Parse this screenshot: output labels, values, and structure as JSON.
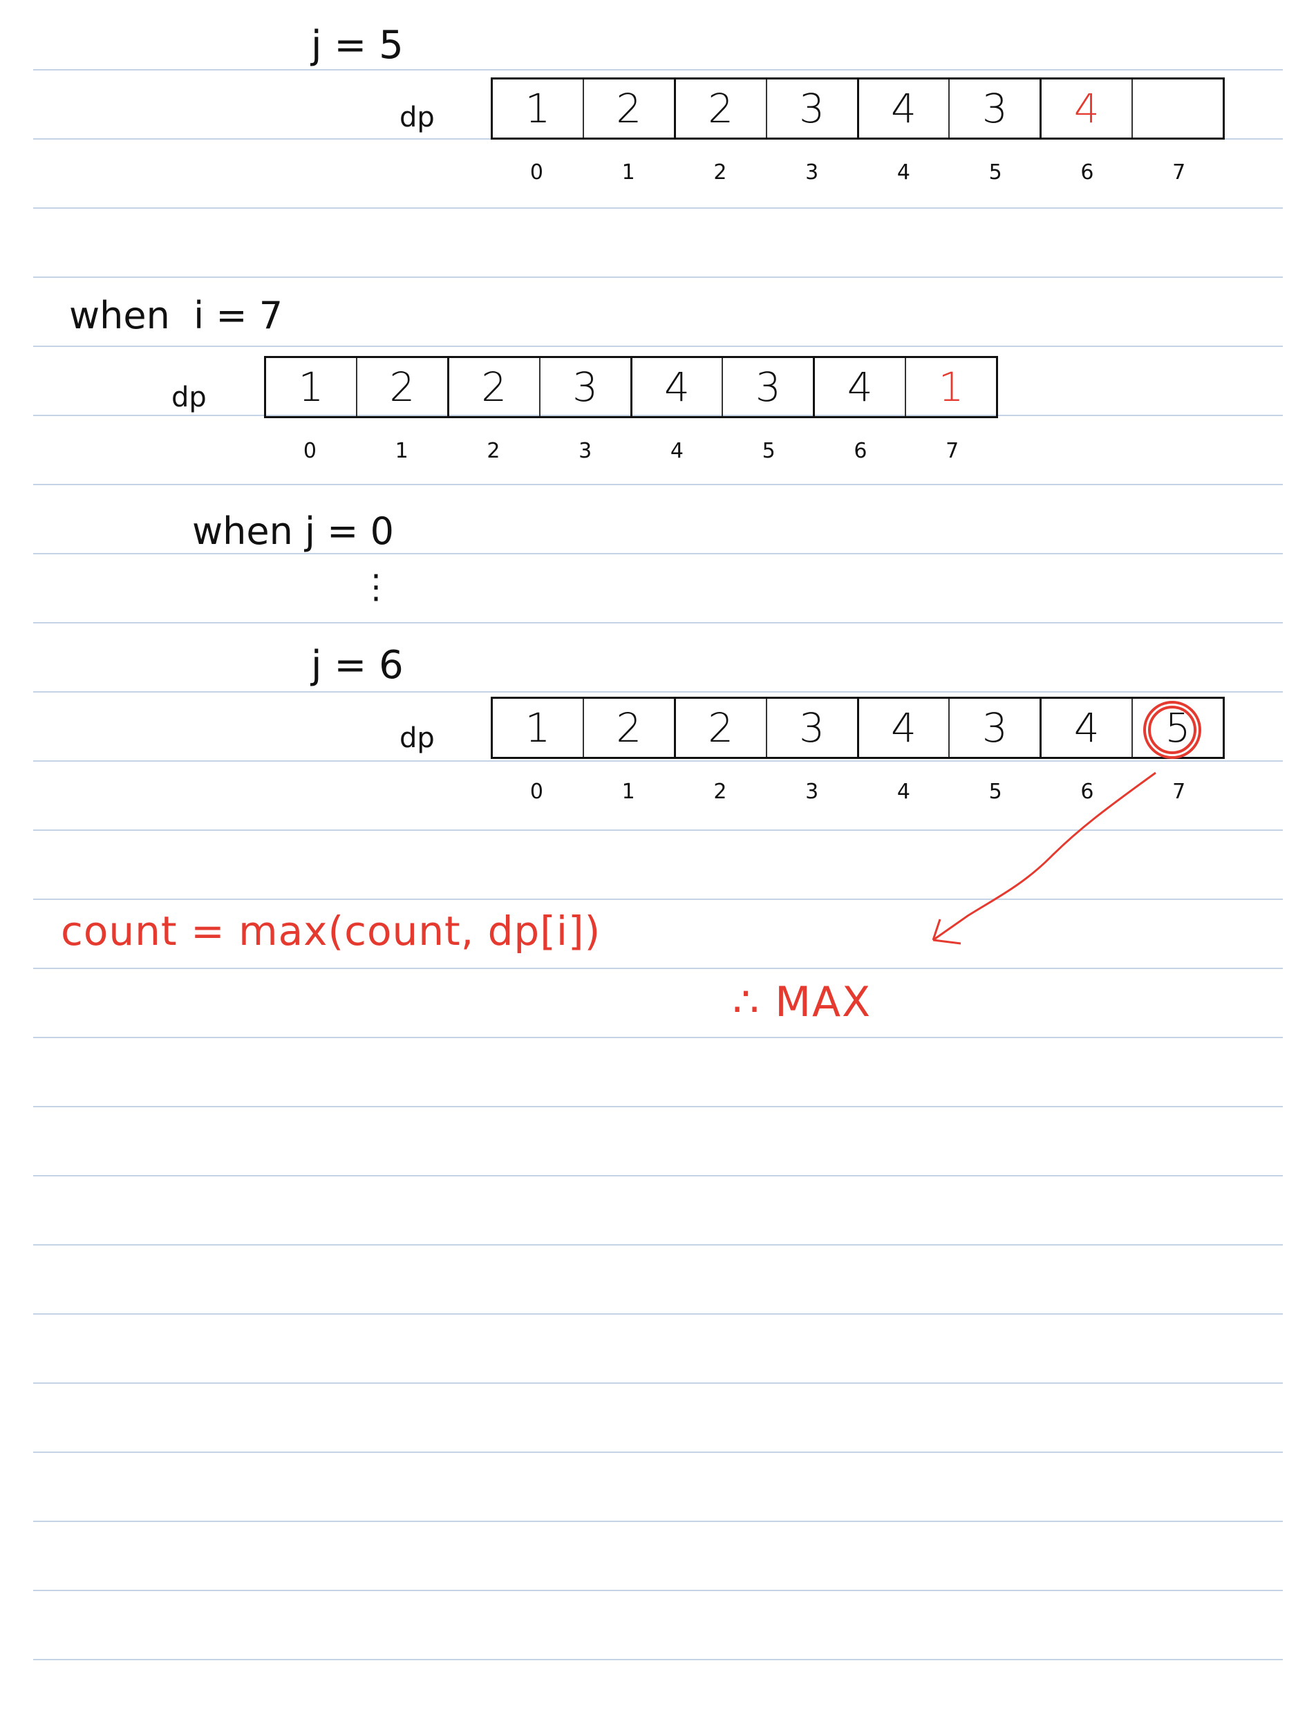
{
  "block1": {
    "header": "j = 5",
    "dp_label": "dp",
    "values": [
      "1",
      "2",
      "2",
      "3",
      "4",
      "3",
      "4",
      ""
    ],
    "indices": [
      "0",
      "1",
      "2",
      "3",
      "4",
      "5",
      "6",
      "7"
    ]
  },
  "block2": {
    "header": "when  i = 7",
    "dp_label": "dp",
    "values": [
      "1",
      "2",
      "2",
      "3",
      "4",
      "3",
      "4",
      "1"
    ],
    "indices": [
      "0",
      "1",
      "2",
      "3",
      "4",
      "5",
      "6",
      "7"
    ]
  },
  "block3": {
    "header": "when j = 0",
    "dots": "⋮",
    "subheader": "j = 6",
    "dp_label": "dp",
    "values": [
      "1",
      "2",
      "2",
      "3",
      "4",
      "3",
      "4",
      "5"
    ],
    "indices": [
      "0",
      "1",
      "2",
      "3",
      "4",
      "5",
      "6",
      "7"
    ]
  },
  "note": {
    "formula": "count = max(count, dp[i])",
    "conclusion": "∴ MAX"
  },
  "colors": {
    "ink": "#111111",
    "accent": "#e53a2f",
    "rule": "#c5d3e6"
  }
}
